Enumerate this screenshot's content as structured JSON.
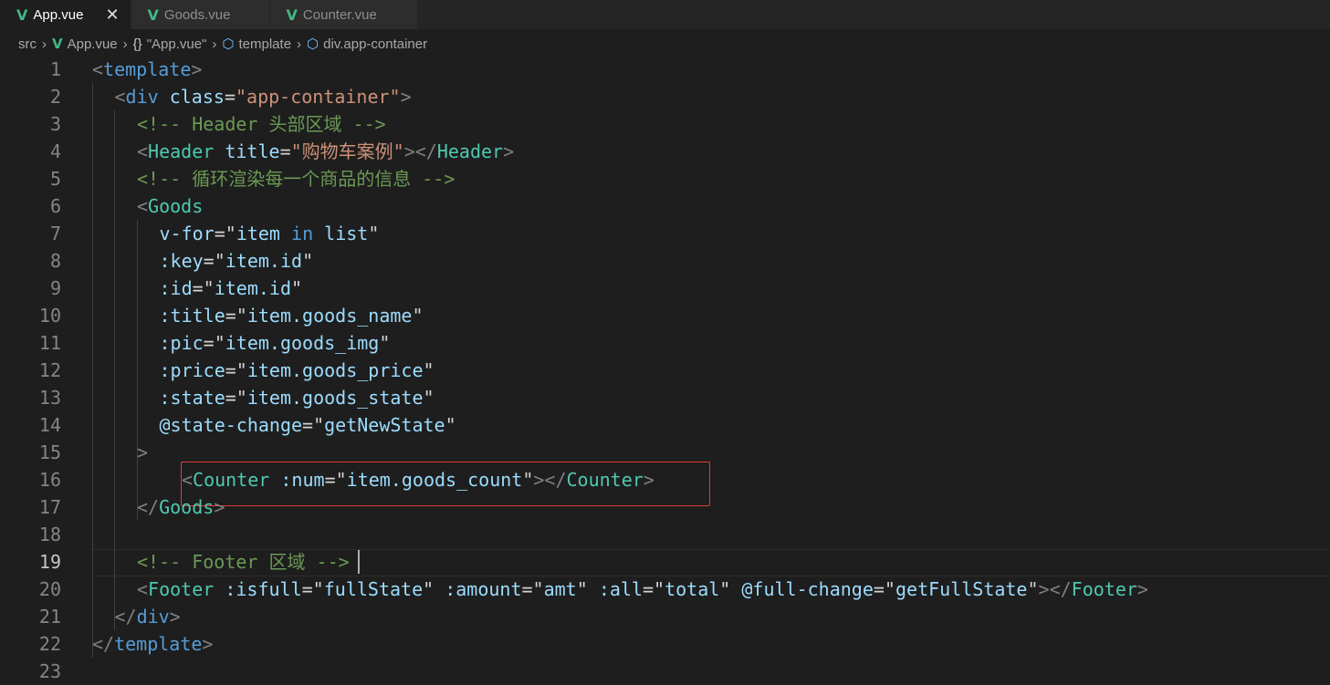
{
  "tabs": [
    {
      "label": "App.vue",
      "active": true,
      "close": "✕"
    },
    {
      "label": "Goods.vue",
      "active": false
    },
    {
      "label": "Counter.vue",
      "active": false
    }
  ],
  "breadcrumb": {
    "items": [
      "src",
      "App.vue",
      "\"App.vue\"",
      "template",
      "div.app-container"
    ],
    "braces": "{}"
  },
  "editor": {
    "current_line": 19,
    "lines": [
      {
        "n": "1",
        "tokens": [
          [
            "t-punc",
            "<"
          ],
          [
            "t-tag2",
            "template"
          ],
          [
            "t-punc",
            ">"
          ]
        ],
        "indent": 0
      },
      {
        "n": "2",
        "tokens": [
          [
            "t-punc",
            "<"
          ],
          [
            "t-tag2",
            "div"
          ],
          [
            "t-plain",
            " "
          ],
          [
            "t-attr",
            "class"
          ],
          [
            "t-plain",
            "="
          ],
          [
            "t-str",
            "\"app-container\""
          ],
          [
            "t-punc",
            ">"
          ]
        ],
        "indent": 1
      },
      {
        "n": "3",
        "tokens": [
          [
            "t-com",
            "<!-- Header 头部区域 -->"
          ]
        ],
        "indent": 2
      },
      {
        "n": "4",
        "tokens": [
          [
            "t-punc",
            "<"
          ],
          [
            "t-tag",
            "Header"
          ],
          [
            "t-plain",
            " "
          ],
          [
            "t-attr",
            "title"
          ],
          [
            "t-plain",
            "="
          ],
          [
            "t-str",
            "\"购物车案例\""
          ],
          [
            "t-punc",
            "></"
          ],
          [
            "t-tag",
            "Header"
          ],
          [
            "t-punc",
            ">"
          ]
        ],
        "indent": 2
      },
      {
        "n": "5",
        "tokens": [
          [
            "t-com",
            "<!-- 循环渲染每一个商品的信息 -->"
          ]
        ],
        "indent": 2
      },
      {
        "n": "6",
        "tokens": [
          [
            "t-punc",
            "<"
          ],
          [
            "t-tag",
            "Goods"
          ]
        ],
        "indent": 2
      },
      {
        "n": "7",
        "tokens": [
          [
            "t-attr",
            "v-for"
          ],
          [
            "t-plain",
            "=\""
          ],
          [
            "t-var",
            "item"
          ],
          [
            "t-plain",
            " "
          ],
          [
            "t-kw",
            "in"
          ],
          [
            "t-plain",
            " "
          ],
          [
            "t-var",
            "list"
          ],
          [
            "t-plain",
            "\""
          ]
        ],
        "indent": 3
      },
      {
        "n": "8",
        "tokens": [
          [
            "t-attr",
            ":key"
          ],
          [
            "t-plain",
            "=\""
          ],
          [
            "t-var",
            "item.id"
          ],
          [
            "t-plain",
            "\""
          ]
        ],
        "indent": 3
      },
      {
        "n": "9",
        "tokens": [
          [
            "t-attr",
            ":id"
          ],
          [
            "t-plain",
            "=\""
          ],
          [
            "t-var",
            "item.id"
          ],
          [
            "t-plain",
            "\""
          ]
        ],
        "indent": 3
      },
      {
        "n": "10",
        "tokens": [
          [
            "t-attr",
            ":title"
          ],
          [
            "t-plain",
            "=\""
          ],
          [
            "t-var",
            "item.goods_name"
          ],
          [
            "t-plain",
            "\""
          ]
        ],
        "indent": 3
      },
      {
        "n": "11",
        "tokens": [
          [
            "t-attr",
            ":pic"
          ],
          [
            "t-plain",
            "=\""
          ],
          [
            "t-var",
            "item.goods_img"
          ],
          [
            "t-plain",
            "\""
          ]
        ],
        "indent": 3
      },
      {
        "n": "12",
        "tokens": [
          [
            "t-attr",
            ":price"
          ],
          [
            "t-plain",
            "=\""
          ],
          [
            "t-var",
            "item.goods_price"
          ],
          [
            "t-plain",
            "\""
          ]
        ],
        "indent": 3
      },
      {
        "n": "13",
        "tokens": [
          [
            "t-attr",
            ":state"
          ],
          [
            "t-plain",
            "=\""
          ],
          [
            "t-var",
            "item.goods_state"
          ],
          [
            "t-plain",
            "\""
          ]
        ],
        "indent": 3
      },
      {
        "n": "14",
        "tokens": [
          [
            "t-attr",
            "@state-change"
          ],
          [
            "t-plain",
            "=\""
          ],
          [
            "t-var",
            "getNewState"
          ],
          [
            "t-plain",
            "\""
          ]
        ],
        "indent": 3
      },
      {
        "n": "15",
        "tokens": [
          [
            "t-punc",
            ">"
          ]
        ],
        "indent": 2
      },
      {
        "n": "16",
        "tokens": [
          [
            "t-punc",
            "<"
          ],
          [
            "t-tag",
            "Counter"
          ],
          [
            "t-plain",
            " "
          ],
          [
            "t-attr",
            ":num"
          ],
          [
            "t-plain",
            "=\""
          ],
          [
            "t-var",
            "item.goods_count"
          ],
          [
            "t-plain",
            "\""
          ],
          [
            "t-punc",
            "></"
          ],
          [
            "t-tag",
            "Counter"
          ],
          [
            "t-punc",
            ">"
          ]
        ],
        "indent": 4
      },
      {
        "n": "17",
        "tokens": [
          [
            "t-punc",
            "</"
          ],
          [
            "t-tag",
            "Goods"
          ],
          [
            "t-punc",
            ">"
          ]
        ],
        "indent": 2
      },
      {
        "n": "18",
        "tokens": [],
        "indent": 0
      },
      {
        "n": "19",
        "tokens": [
          [
            "t-com",
            "<!-- Footer 区域 -->"
          ]
        ],
        "indent": 2
      },
      {
        "n": "20",
        "tokens": [
          [
            "t-punc",
            "<"
          ],
          [
            "t-tag",
            "Footer"
          ],
          [
            "t-plain",
            " "
          ],
          [
            "t-attr",
            ":isfull"
          ],
          [
            "t-plain",
            "=\""
          ],
          [
            "t-var",
            "fullState"
          ],
          [
            "t-plain",
            "\" "
          ],
          [
            "t-attr",
            ":amount"
          ],
          [
            "t-plain",
            "=\""
          ],
          [
            "t-var",
            "amt"
          ],
          [
            "t-plain",
            "\" "
          ],
          [
            "t-attr",
            ":all"
          ],
          [
            "t-plain",
            "=\""
          ],
          [
            "t-var",
            "total"
          ],
          [
            "t-plain",
            "\" "
          ],
          [
            "t-attr",
            "@full-change"
          ],
          [
            "t-plain",
            "=\""
          ],
          [
            "t-var",
            "getFullState"
          ],
          [
            "t-plain",
            "\""
          ],
          [
            "t-punc",
            "></"
          ],
          [
            "t-tag",
            "Footer"
          ],
          [
            "t-punc",
            ">"
          ]
        ],
        "indent": 2
      },
      {
        "n": "21",
        "tokens": [
          [
            "t-punc",
            "</"
          ],
          [
            "t-tag2",
            "div"
          ],
          [
            "t-punc",
            ">"
          ]
        ],
        "indent": 1
      },
      {
        "n": "22",
        "tokens": [
          [
            "t-punc",
            "</"
          ],
          [
            "t-tag2",
            "template"
          ],
          [
            "t-punc",
            ">"
          ]
        ],
        "indent": 0
      },
      {
        "n": "23",
        "tokens": [],
        "indent": 0
      }
    ]
  },
  "colors": {
    "background": "#1e1e1e",
    "vue_icon": "#41b883",
    "highlight_box": "#e03c3c"
  },
  "icons": {
    "vue": "vue-file-icon",
    "close": "close-icon",
    "braces": "braces-icon",
    "symbol": "symbol-cube-icon"
  }
}
